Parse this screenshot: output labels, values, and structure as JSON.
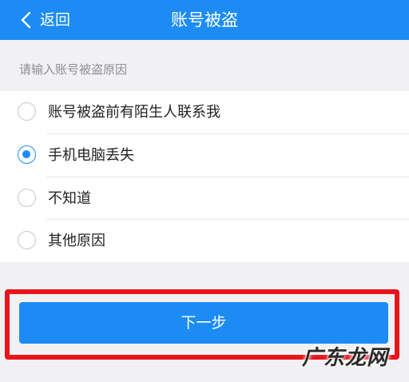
{
  "nav": {
    "back_label": "返回",
    "title": "账号被盗"
  },
  "prompt": "请输入账号被盗原因",
  "options": [
    {
      "label": "账号被盗前有陌生人联系我",
      "selected": false
    },
    {
      "label": "手机电脑丢失",
      "selected": true
    },
    {
      "label": "不知道",
      "selected": false
    },
    {
      "label": "其他原因",
      "selected": false
    }
  ],
  "next_button": {
    "label": "下一步"
  },
  "watermark": "广东龙网",
  "colors": {
    "accent": "#1c8cf4",
    "highlight_frame": "#e8151b",
    "background": "#f1f1f3"
  },
  "icons": {
    "back": "chevron-left-icon",
    "radio_on": "radio-checked-icon",
    "radio_off": "radio-unchecked-icon"
  }
}
